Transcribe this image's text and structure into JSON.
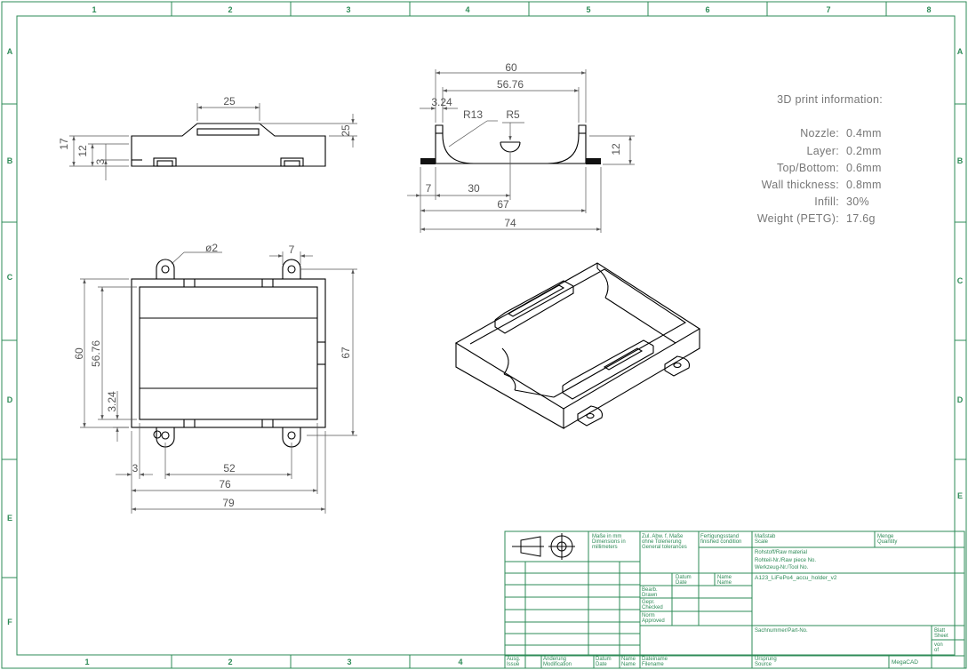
{
  "zones": {
    "cols_top": [
      "1",
      "2",
      "3",
      "4",
      "5",
      "6",
      "7",
      "8"
    ],
    "cols_bottom": [
      "1",
      "2",
      "3",
      "4"
    ],
    "rows": [
      "A",
      "B",
      "C",
      "D",
      "E",
      "F"
    ]
  },
  "dimensions": {
    "side": {
      "d25": "25",
      "d17": "17",
      "d12": "12",
      "d3": "3",
      "d25r": "25"
    },
    "front": {
      "d60": "60",
      "d5676": "56.76",
      "d324": "3.24",
      "r13": "R13",
      "r5": "R5",
      "d12": "12",
      "d7": "7",
      "d30": "30",
      "d67": "67",
      "d74": "74"
    },
    "top": {
      "dia2": "ø2",
      "d7": "7",
      "d60": "60",
      "d5676": "56.76",
      "d324": "3.24",
      "d67": "67",
      "d3": "3",
      "d52": "52",
      "d76": "76",
      "d79": "79"
    }
  },
  "print_info": {
    "heading": "3D print information:",
    "rows": [
      {
        "label": "Nozzle:",
        "value": "0.4mm"
      },
      {
        "label": "Layer:",
        "value": "0.2mm"
      },
      {
        "label": "Top/Bottom:",
        "value": "0.6mm"
      },
      {
        "label": "Wall thickness:",
        "value": "0.8mm"
      },
      {
        "label": "Infill:",
        "value": "30%"
      },
      {
        "label": "Weight (PETG):",
        "value": "17.6g"
      }
    ]
  },
  "title_block": {
    "dims_l1": "Maße in mm",
    "dims_l2": "Dimensions in",
    "dims_l3": "millimeters",
    "tol_l1": "Zul. Abw. f. Maße",
    "tol_l2": "ohne Tolerierung",
    "tol_l3": "General tolerances",
    "fin_l1": "Fertigungsstand",
    "fin_l2": "finished condition",
    "scale_l1": "Maßstab",
    "scale_l2": "Scale",
    "qty_l1": "Menge",
    "qty_l2": "Quantity",
    "raw_l1": "Rohstoff/Raw material",
    "raw_l2": "Rohteil-Nr./Raw piece No.",
    "raw_l3": "Werkzeug-Nr./Tool No.",
    "date_l1": "Datum",
    "date_l2": "Date",
    "name_l1": "Name",
    "name_l2": "Name",
    "drawn_l1": "Bearb.",
    "drawn_l2": "Drawn",
    "checked_l1": "Gepr.",
    "checked_l2": "Checked",
    "approved_l1": "Norm",
    "approved_l2": "Approved",
    "title": "A123_LiFePo4_accu_holder_v2",
    "part_no": "Sachnummer/Part-No.",
    "sheet_l1": "Blatt",
    "sheet_l2": "Sheet",
    "of_l1": "von",
    "of_l2": "of",
    "issue_l1": "Ausg.",
    "issue_l2": "Issue",
    "mod_l1": "Änderung",
    "mod_l2": "Modification",
    "bdate_l1": "Datum",
    "bdate_l2": "Date",
    "bname_l1": "Name",
    "bname_l2": "Name",
    "file_l1": "Dateiname",
    "file_l2": "Filename",
    "src_l1": "Ursprung",
    "src_l2": "Source",
    "software": "MegaCAD"
  },
  "colors": {
    "frame": "#2e8b57",
    "object": "#000000",
    "dimension": "#555555",
    "info": "#777777"
  }
}
